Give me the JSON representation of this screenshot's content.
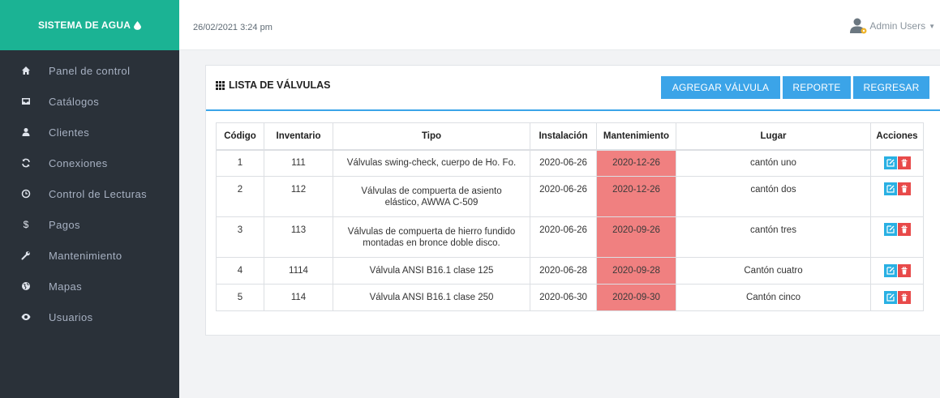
{
  "app": {
    "brand": "SISTEMA DE AGUA"
  },
  "header": {
    "datetime": "26/02/2021 3:24 pm",
    "user_name": "Admin Users"
  },
  "sidebar": {
    "items": [
      {
        "label": "Panel de control",
        "icon": "home-icon"
      },
      {
        "label": "Catálogos",
        "icon": "inbox-icon"
      },
      {
        "label": "Clientes",
        "icon": "user-icon"
      },
      {
        "label": "Conexiones",
        "icon": "refresh-icon"
      },
      {
        "label": "Control de Lecturas",
        "icon": "clock-icon"
      },
      {
        "label": "Pagos",
        "icon": "dollar-icon"
      },
      {
        "label": "Mantenimiento",
        "icon": "wrench-icon"
      },
      {
        "label": "Mapas",
        "icon": "globe-icon"
      },
      {
        "label": "Usuarios",
        "icon": "eye-icon"
      }
    ]
  },
  "panel": {
    "title": "LISTA DE VÁLVULAS",
    "buttons": {
      "add": "AGREGAR VÁLVULA",
      "report": "REPORTE",
      "back": "REGRESAR"
    }
  },
  "table": {
    "headers": [
      "Código",
      "Inventario",
      "Tipo",
      "Instalación",
      "Mantenimiento",
      "Lugar",
      "Acciones"
    ],
    "rows": [
      {
        "codigo": "1",
        "inventario": "111",
        "tipo": "Válvulas swing-check, cuerpo de Ho. Fo.",
        "instalacion": "2020-06-26",
        "mantenimiento": "2020-12-26",
        "lugar": "cantón uno"
      },
      {
        "codigo": "2",
        "inventario": "112",
        "tipo": "Válvulas de compuerta de asiento elástico, AWWA C-509",
        "instalacion": "2020-06-26",
        "mantenimiento": "2020-12-26",
        "lugar": "cantón dos"
      },
      {
        "codigo": "3",
        "inventario": "113",
        "tipo": "Válvulas de compuerta de hierro fundido montadas en bronce doble disco.",
        "instalacion": "2020-06-26",
        "mantenimiento": "2020-09-26",
        "lugar": "cantón tres"
      },
      {
        "codigo": "4",
        "inventario": "1114",
        "tipo": "Válvula ANSI B16.1 clase 125",
        "instalacion": "2020-06-28",
        "mantenimiento": "2020-09-28",
        "lugar": "Cantón cuatro"
      },
      {
        "codigo": "5",
        "inventario": "114",
        "tipo": "Válvula ANSI B16.1 clase 250",
        "instalacion": "2020-06-30",
        "mantenimiento": "2020-09-30",
        "lugar": "Cantón cinco"
      }
    ]
  },
  "colors": {
    "brand": "#1bb394",
    "sidebar": "#2a3139",
    "accent": "#3ba4e8",
    "overdue": "#f08080",
    "edit": "#29b0e3",
    "delete": "#e84a4a"
  }
}
